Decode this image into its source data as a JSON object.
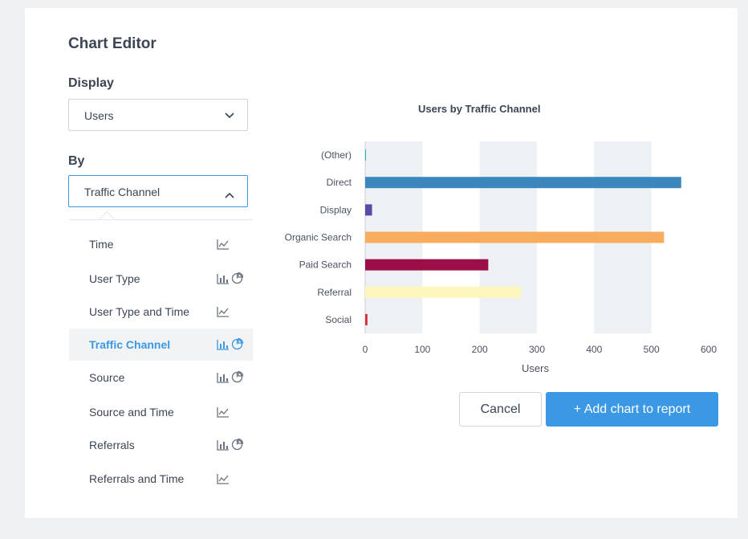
{
  "editor": {
    "title": "Chart Editor"
  },
  "display": {
    "label": "Display",
    "selected": "Users"
  },
  "by": {
    "label": "By",
    "selected": "Traffic Channel",
    "options": [
      {
        "label": "Time",
        "icons": [
          "line-chart-icon"
        ]
      },
      {
        "label": "User Type",
        "icons": [
          "bar-chart-icon",
          "pie-chart-icon"
        ]
      },
      {
        "label": "User Type and Time",
        "icons": [
          "line-chart-icon"
        ]
      },
      {
        "label": "Traffic Channel",
        "icons": [
          "bar-chart-icon",
          "pie-chart-icon"
        ],
        "selected": true
      },
      {
        "label": "Source",
        "icons": [
          "bar-chart-icon",
          "pie-chart-icon"
        ]
      },
      {
        "label": "Source and Time",
        "icons": [
          "line-chart-icon"
        ]
      },
      {
        "label": "Referrals",
        "icons": [
          "bar-chart-icon",
          "pie-chart-icon"
        ]
      },
      {
        "label": "Referrals and Time",
        "icons": [
          "line-chart-icon"
        ]
      }
    ]
  },
  "buttons": {
    "cancel": "Cancel",
    "add": "+ Add chart to report"
  },
  "colors": {
    "accent": "#3b98e5",
    "band": "#eef1f4"
  },
  "chart_data": {
    "type": "bar",
    "orientation": "horizontal",
    "title": "Users by Traffic Channel",
    "xlabel": "Users",
    "ylabel": "",
    "categories": [
      "(Other)",
      "Direct",
      "Display",
      "Organic Search",
      "Paid Search",
      "Referral",
      "Social"
    ],
    "values": [
      1,
      552,
      12,
      522,
      215,
      272,
      4
    ],
    "colors": [
      "#2bb3a8",
      "#3a86bd",
      "#5b4aa3",
      "#f8ac5e",
      "#9b0e47",
      "#fdf7be",
      "#d92e3c"
    ],
    "xlim": [
      0,
      600
    ],
    "xticks": [
      0,
      100,
      200,
      300,
      400,
      500,
      600
    ],
    "grid": "alternating vertical bands"
  }
}
